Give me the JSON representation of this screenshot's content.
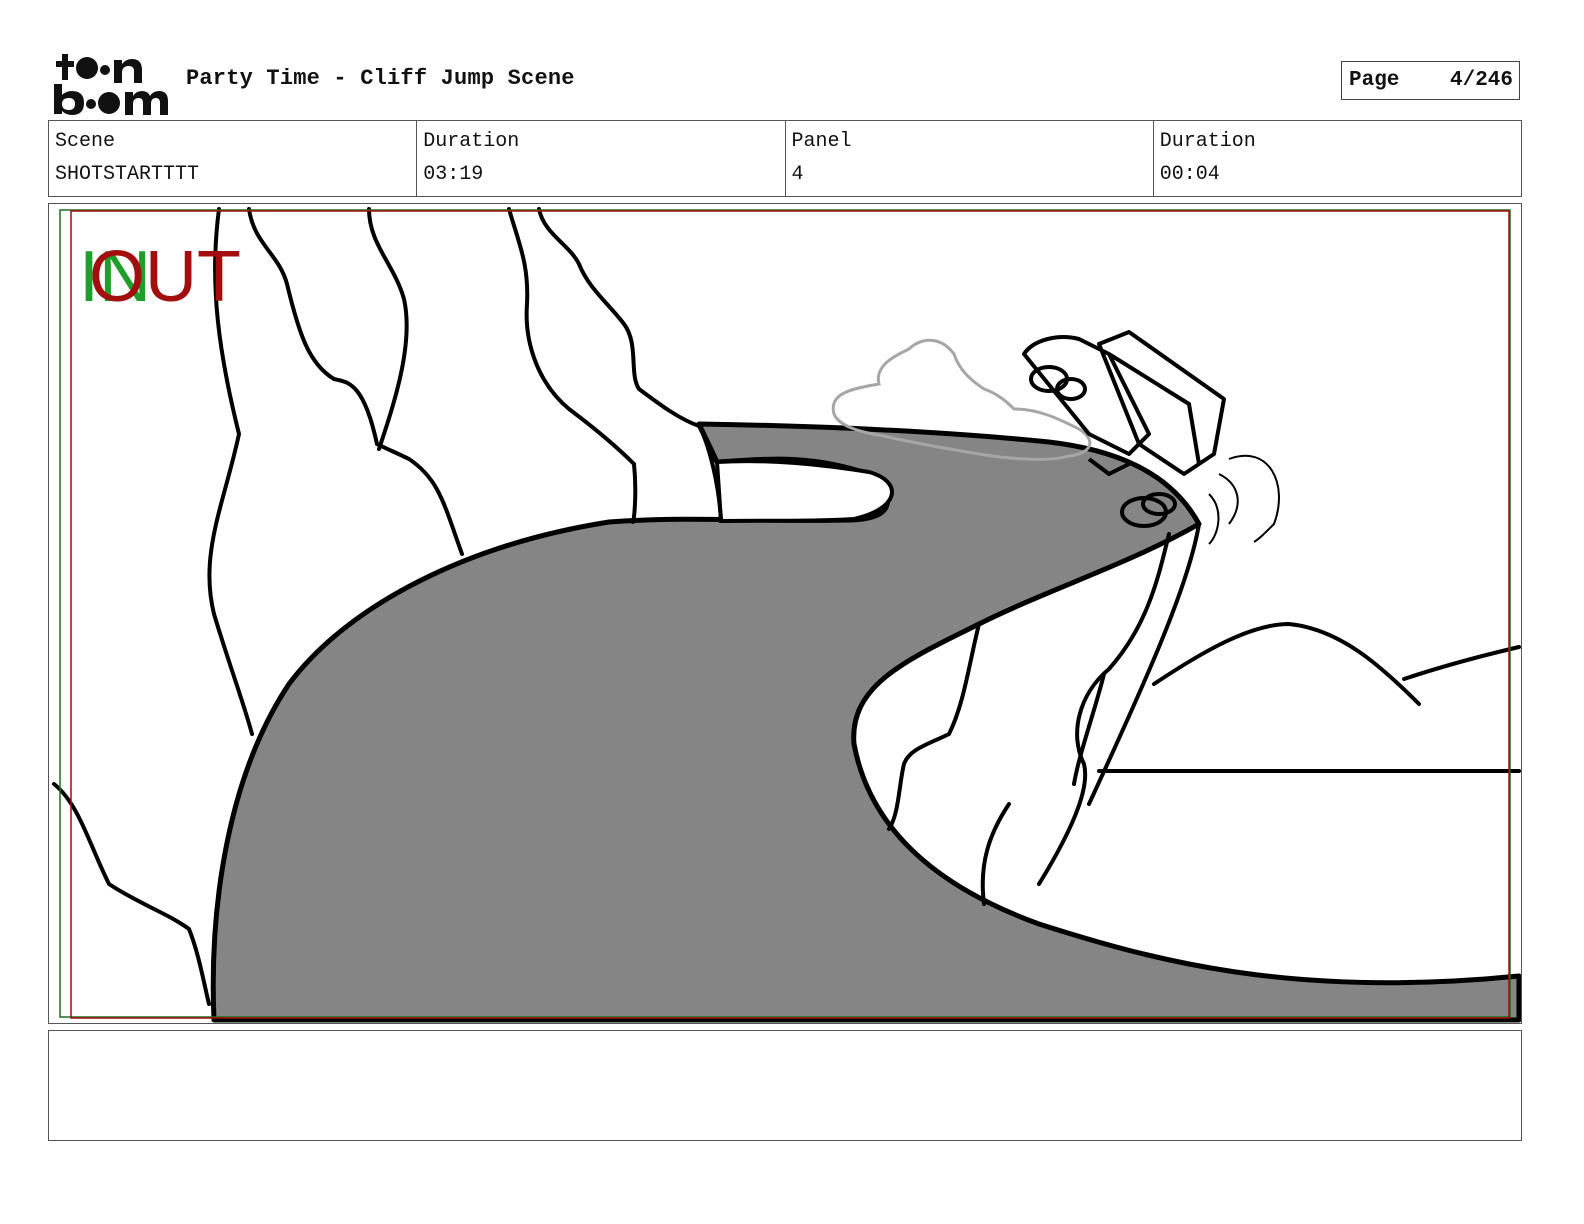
{
  "header": {
    "logo_text": "toon boom",
    "title": "Party Time - Cliff Jump Scene",
    "page_label": "Page",
    "page_value": "4/246"
  },
  "info": {
    "scene_label": "Scene",
    "scene_value": "SHOTSTARTTTT",
    "scene_duration_label": "Duration",
    "scene_duration_value": "03:19",
    "panel_label": "Panel",
    "panel_value": "4",
    "panel_duration_label": "Duration",
    "panel_duration_value": "00:04"
  },
  "panel": {
    "in_marker": "IN",
    "out_marker": "OUT",
    "colors": {
      "in_marker": "#1f9e2b",
      "out_marker": "#a30f0f",
      "road_fill": "#858585",
      "line": "#000000",
      "dust": "#a6a6a6"
    }
  },
  "notes": {
    "text": ""
  }
}
